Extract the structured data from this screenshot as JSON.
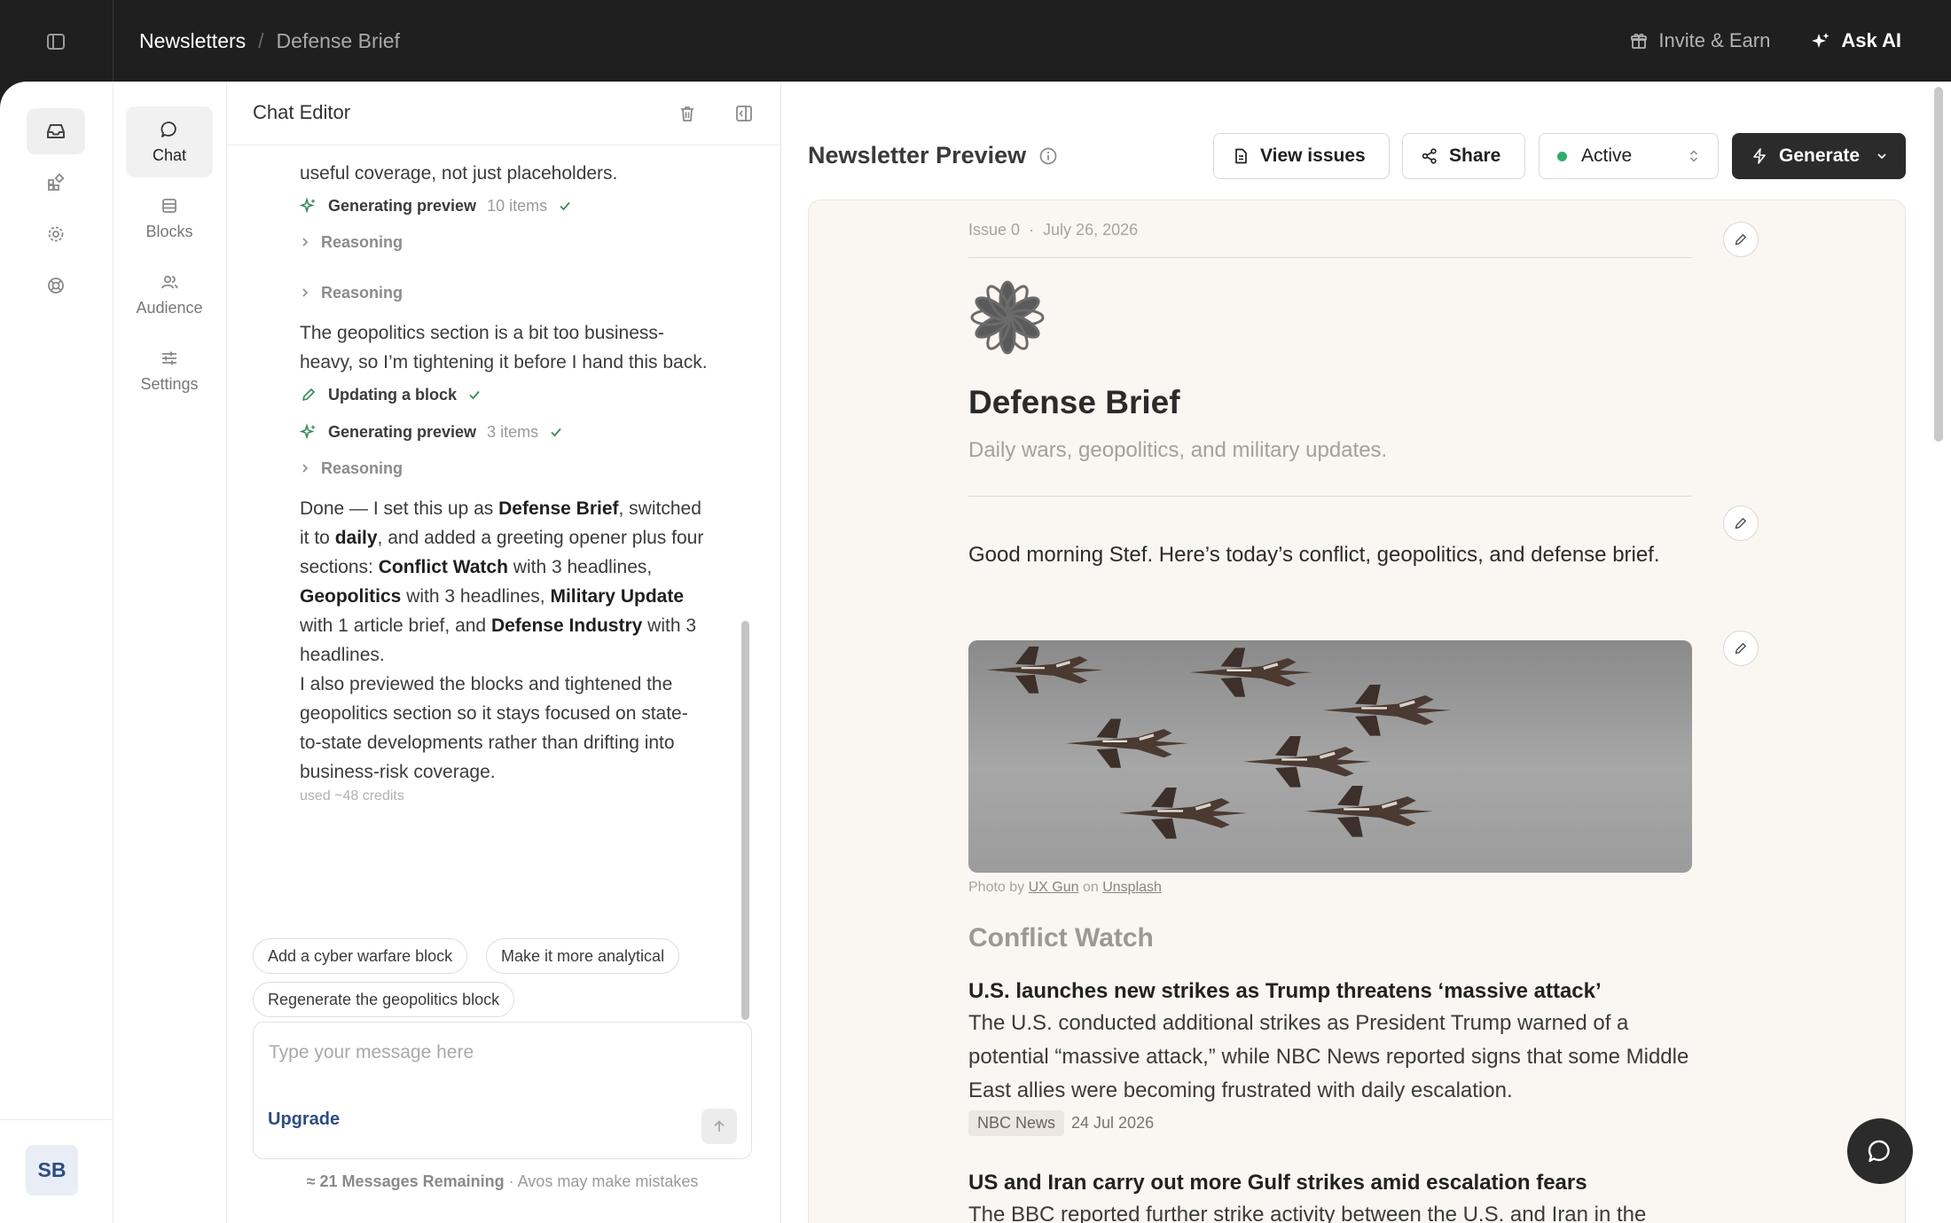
{
  "topbar": {
    "breadcrumb": [
      "Newsletters",
      "Defense Brief"
    ],
    "separator": "/",
    "invite": "Invite & Earn",
    "ask_ai": "Ask AI"
  },
  "rail": {
    "avatar": "SB"
  },
  "subnav": [
    {
      "label": "Chat",
      "icon": "chat-bubble-icon"
    },
    {
      "label": "Blocks",
      "icon": "blocks-icon"
    },
    {
      "label": "Audience",
      "icon": "audience-icon"
    },
    {
      "label": "Settings",
      "icon": "sliders-icon"
    }
  ],
  "chat": {
    "title": "Chat Editor",
    "intro": "useful coverage, not just placeholders.",
    "step1": {
      "label": "Generating preview",
      "count": "10 items"
    },
    "reasoning": "Reasoning",
    "para1": "The geopolitics section is a bit too business-heavy, so I’m tightening it before I hand this back.",
    "step2": {
      "label": "Updating a block"
    },
    "step3": {
      "label": "Generating preview",
      "count": "3 items"
    },
    "final": {
      "a": "Done — I set this up as ",
      "b": "Defense Brief",
      "c": ", switched it to ",
      "d": "daily",
      "e": ", and added a greeting opener plus four sections: ",
      "f": "Conflict Watch",
      "g": " with 3 headlines, ",
      "h": "Geopolitics",
      "i": " with 3 headlines, ",
      "j": "Military Update",
      "k": " with 1 article brief, and ",
      "l": "Defense Industry",
      "m": " with 3 headlines."
    },
    "para2": "I also previewed the blocks and tightened the geopolitics section so it stays focused on state-to-state developments rather than drifting into business-risk coverage.",
    "credits": "used ~48 credits",
    "chips": [
      "Add a cyber warfare block",
      "Make it more analytical",
      "Regenerate the geopolitics block"
    ],
    "input_placeholder": "Type your message here",
    "upgrade": "Upgrade",
    "remaining_bold": "≈ 21 Messages Remaining",
    "remaining_rest": " · Avos may make mistakes"
  },
  "preview": {
    "title": "Newsletter Preview",
    "view_issues": "View issues",
    "share": "Share",
    "status": "Active",
    "generate": "Generate",
    "issue": "Issue 0",
    "dot": "·",
    "date": "July 26, 2026",
    "newsletter_title": "Defense Brief",
    "newsletter_subtitle": "Daily wars, geopolitics, and military updates.",
    "greeting": "Good morning Stef. Here’s today’s conflict, geopolitics, and defense brief.",
    "photo_credit": {
      "prefix": "Photo by ",
      "author": "UX Gun",
      "mid": " on ",
      "site": "Unsplash"
    },
    "section": "Conflict Watch",
    "articles": [
      {
        "headline": "U.S. launches new strikes as Trump threatens ‘massive attack’",
        "body": "The U.S. conducted additional strikes as President Trump warned of a potential “massive attack,” while NBC News reported signs that some Middle East allies were becoming frustrated with daily escalation.",
        "source": "NBC News",
        "date": "24 Jul 2026"
      },
      {
        "headline": "US and Iran carry out more Gulf strikes amid escalation fears",
        "body": "The BBC reported further strike activity between the U.S. and Iran in the"
      }
    ]
  },
  "colors": {
    "accent_dark": "#2b2b2b",
    "status_green": "#2fae6b",
    "link_blue": "#2f4d83",
    "preview_bg": "#faf6f1"
  }
}
